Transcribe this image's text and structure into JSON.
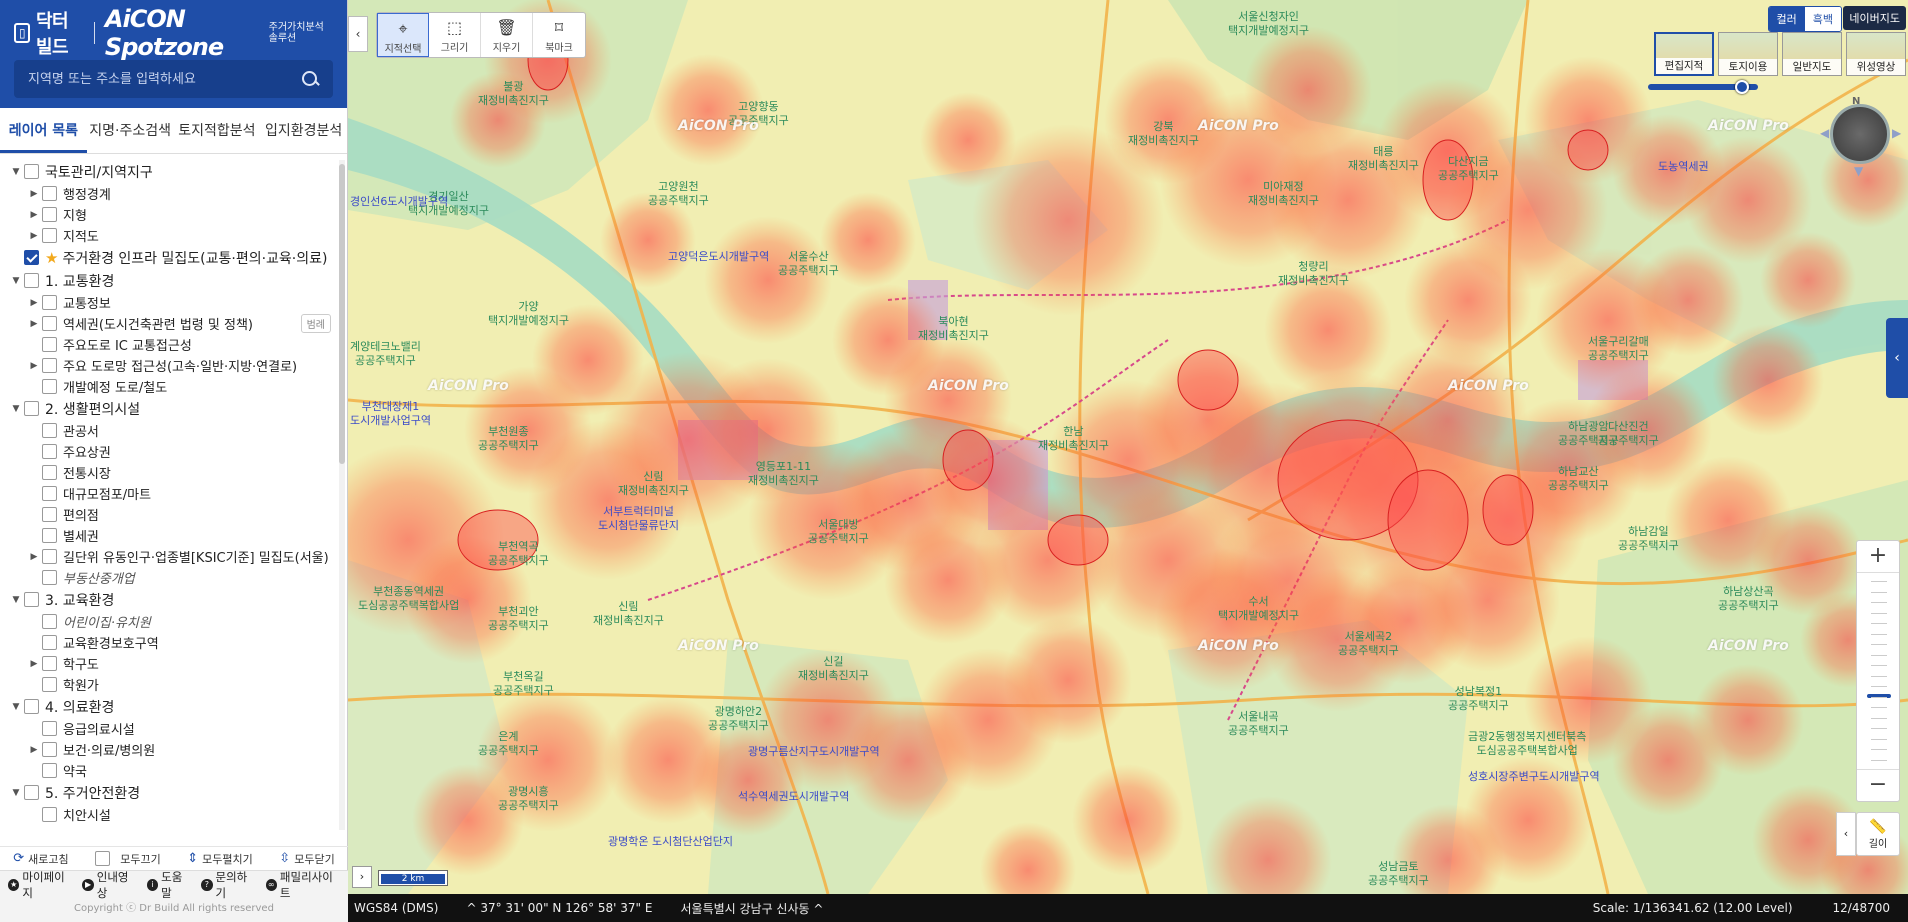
{
  "brand": {
    "logo_text": "닥터빌드",
    "product": "AiCON Spotzone",
    "tagline": "주거가치분석솔루션"
  },
  "search": {
    "placeholder": "지역명 또는 주소를 입력하세요",
    "value": ""
  },
  "tabs": [
    {
      "label": "레이어 목록",
      "active": true
    },
    {
      "label": "지명·주소검색",
      "active": false
    },
    {
      "label": "토지적합분석",
      "active": false
    },
    {
      "label": "입지환경분석",
      "active": false
    }
  ],
  "layers": [
    {
      "label": "국토관리/지역지구",
      "level": 0,
      "caret": "down",
      "checked": false
    },
    {
      "label": "행정경계",
      "level": 1,
      "caret": "right",
      "checked": false
    },
    {
      "label": "지형",
      "level": 1,
      "caret": "right",
      "checked": false
    },
    {
      "label": "지적도",
      "level": 1,
      "caret": "right",
      "checked": false
    },
    {
      "label": "주거환경 인프라 밀집도(교통·편의·교육·의료)",
      "level": 0,
      "caret": "none",
      "checked": true,
      "star": true
    },
    {
      "label": "1. 교통환경",
      "level": 0,
      "caret": "down",
      "checked": false
    },
    {
      "label": "교통정보",
      "level": 1,
      "caret": "right",
      "checked": false
    },
    {
      "label": "역세권(도시건축관련 법령 및 정책)",
      "level": 1,
      "caret": "right",
      "checked": false,
      "badge": "범례"
    },
    {
      "label": "주요도로 IC 교통접근성",
      "level": 1,
      "caret": "none",
      "checked": false
    },
    {
      "label": "주요 도로망 접근성(고속·일반·지방·연결로)",
      "level": 1,
      "caret": "right",
      "checked": false
    },
    {
      "label": "개발예정 도로/철도",
      "level": 1,
      "caret": "none",
      "checked": false
    },
    {
      "label": "2. 생활편의시설",
      "level": 0,
      "caret": "down",
      "checked": false
    },
    {
      "label": "관공서",
      "level": 1,
      "caret": "none",
      "checked": false
    },
    {
      "label": "주요상권",
      "level": 1,
      "caret": "none",
      "checked": false
    },
    {
      "label": "전통시장",
      "level": 1,
      "caret": "none",
      "checked": false
    },
    {
      "label": "대규모점포/마트",
      "level": 1,
      "caret": "none",
      "checked": false
    },
    {
      "label": "편의점",
      "level": 1,
      "caret": "none",
      "checked": false
    },
    {
      "label": "별세권",
      "level": 1,
      "caret": "none",
      "checked": false
    },
    {
      "label": "길단위 유동인구·업종별[KSIC기준] 밀집도(서울)",
      "level": 1,
      "caret": "right",
      "checked": false
    },
    {
      "label": "부동산중개업",
      "level": 1,
      "caret": "none",
      "checked": false,
      "italic": true
    },
    {
      "label": "3. 교육환경",
      "level": 0,
      "caret": "down",
      "checked": false
    },
    {
      "label": "어린이집·유치원",
      "level": 1,
      "caret": "none",
      "checked": false,
      "italic": true
    },
    {
      "label": "교육환경보호구역",
      "level": 1,
      "caret": "none",
      "checked": false
    },
    {
      "label": "학구도",
      "level": 1,
      "caret": "right",
      "checked": false
    },
    {
      "label": "학원가",
      "level": 1,
      "caret": "none",
      "checked": false
    },
    {
      "label": "4. 의료환경",
      "level": 0,
      "caret": "down",
      "checked": false
    },
    {
      "label": "응급의료시설",
      "level": 1,
      "caret": "none",
      "checked": false
    },
    {
      "label": "보건·의료/병의원",
      "level": 1,
      "caret": "right",
      "checked": false
    },
    {
      "label": "약국",
      "level": 1,
      "caret": "none",
      "checked": false
    },
    {
      "label": "5. 주거안전환경",
      "level": 0,
      "caret": "down",
      "checked": false
    },
    {
      "label": "치안시설",
      "level": 1,
      "caret": "none",
      "checked": false
    }
  ],
  "actions": {
    "refresh": "새로고침",
    "all_off": "모두끄기",
    "expand_all": "모두펼치기",
    "collapse_all": "모두닫기"
  },
  "footer": {
    "links": [
      {
        "icon": "★",
        "label": "마이페이지"
      },
      {
        "icon": "▶",
        "label": "인내영상"
      },
      {
        "icon": "i",
        "label": "도움말"
      },
      {
        "icon": "?",
        "label": "문의하기"
      },
      {
        "icon": "∞",
        "label": "패밀리사이트"
      }
    ],
    "copyright": "Copyright ⓒ Dr Build All rights reserved"
  },
  "toolbar": {
    "tools": [
      {
        "label": "지적선택",
        "icon": "⌖",
        "active": true
      },
      {
        "label": "그리기",
        "icon": "⬚",
        "active": false
      },
      {
        "label": "지우기",
        "icon": "🗑",
        "active": false
      },
      {
        "label": "북마크",
        "icon": "⌑",
        "active": false
      }
    ]
  },
  "map_controls": {
    "color_mode": "컬러",
    "gray_mode": "흑백",
    "naver_label": "네이버지도",
    "map_types": [
      {
        "label": "편집지적",
        "active": true
      },
      {
        "label": "토지이용",
        "active": false
      },
      {
        "label": "일반지도",
        "active": false
      },
      {
        "label": "위성영상",
        "active": false
      }
    ],
    "compass_label": "N",
    "zoom_in": "+",
    "zoom_out": "−",
    "zoom_level_fraction": 0.62,
    "measure_label": "길이",
    "opacity_fraction": 0.85
  },
  "scale_bar": {
    "label": "2 km"
  },
  "status": {
    "crs": "WGS84 (DMS)",
    "coords": "37° 31' 00\" N 126° 58' 37\" E",
    "address": "서울특별시 강남구 신사동",
    "scale": "Scale: 1/136341.62 (12.00 Level)",
    "zoom_info": "12/48700"
  },
  "watermark": "AiCON Pro",
  "places": [
    {
      "text": "불광\n재정비촉진지구",
      "cls": "g"
    },
    {
      "text": "고양향동\n공공주택지구",
      "cls": "g"
    },
    {
      "text": "고양원천\n공공주택지구",
      "cls": "g"
    },
    {
      "text": "고양덕은도시개발구역",
      "cls": "b"
    },
    {
      "text": "서울수산\n공공주택지구",
      "cls": "g"
    },
    {
      "text": "가양\n택지개발예정지구",
      "cls": "g"
    },
    {
      "text": "계양테크노밸리\n공공주택지구",
      "cls": "g"
    },
    {
      "text": "부천대장제1\n도시개발사업구역",
      "cls": "b"
    },
    {
      "text": "부천원종\n공공주택지구",
      "cls": "g"
    },
    {
      "text": "신림\n재정비촉진지구",
      "cls": "g"
    },
    {
      "text": "영등포1-11\n재정비촉진지구",
      "cls": "g"
    },
    {
      "text": "서부트럭터미널\n도시첨단물류단지",
      "cls": "b"
    },
    {
      "text": "부천역곡\n공공주택지구",
      "cls": "g"
    },
    {
      "text": "부천종동역세권\n도심공공주택복합사업",
      "cls": "g"
    },
    {
      "text": "부천괴안\n공공주택지구",
      "cls": "g"
    },
    {
      "text": "신림\n재정비촉진지구",
      "cls": "g"
    },
    {
      "text": "서울대방\n공공주택지구",
      "cls": "g"
    },
    {
      "text": "신길\n재정비촉진지구",
      "cls": "g"
    },
    {
      "text": "부천옥길\n공공주택지구",
      "cls": "g"
    },
    {
      "text": "광명하안2\n공공주택지구",
      "cls": "g"
    },
    {
      "text": "광명구름산지구도시개발구역",
      "cls": "b"
    },
    {
      "text": "은계\n공공주택지구",
      "cls": "g"
    },
    {
      "text": "광명시흥\n공공주택지구",
      "cls": "g"
    },
    {
      "text": "석수역세권도시개발구역",
      "cls": "b"
    },
    {
      "text": "광명학온 도시첨단산업단지",
      "cls": "b"
    },
    {
      "text": "북아현\n재정비촉진지구",
      "cls": "g"
    },
    {
      "text": "한남\n재정비촉진지구",
      "cls": "g"
    },
    {
      "text": "강북\n재정비촉진지구",
      "cls": "g"
    },
    {
      "text": "미아재정\n재정비촉진지구",
      "cls": "g"
    },
    {
      "text": "청량리\n재정비촉진지구",
      "cls": "g"
    },
    {
      "text": "태릉\n재정비촉진지구",
      "cls": "g"
    },
    {
      "text": "다산지금\n공공주택지구",
      "cls": "g"
    },
    {
      "text": "서울구리갈매\n공공주택지구",
      "cls": "g"
    },
    {
      "text": "하남광암\n공공주택지구",
      "cls": "g"
    },
    {
      "text": "하남교산\n공공주택지구",
      "cls": "g"
    },
    {
      "text": "하남감일\n공공주택지구",
      "cls": "g"
    },
    {
      "text": "수서\n택지개발예정지구",
      "cls": "g"
    },
    {
      "text": "서울세곡2\n공공주택지구",
      "cls": "g"
    },
    {
      "text": "성남복정1\n공공주택지구",
      "cls": "g"
    },
    {
      "text": "서울내곡\n공공주택지구",
      "cls": "g"
    },
    {
      "text": "금광2동행정복지센터북측\n도심공공주택복합사업",
      "cls": "g"
    },
    {
      "text": "성호시장주변구도시개발구역",
      "cls": "b"
    },
    {
      "text": "하남상산곡\n공공주택지구",
      "cls": "g"
    },
    {
      "text": "성남금토\n공공주택지구",
      "cls": "g"
    },
    {
      "text": "서울신청자인\n택지개발예정지구",
      "cls": "g"
    },
    {
      "text": "경기일산\n택지개발예정지구",
      "cls": "g"
    },
    {
      "text": "경인선6도시개발구역",
      "cls": "b"
    },
    {
      "text": "도농역세권",
      "cls": "b"
    },
    {
      "text": "다산진건\n공공주택지구",
      "cls": "g"
    }
  ]
}
